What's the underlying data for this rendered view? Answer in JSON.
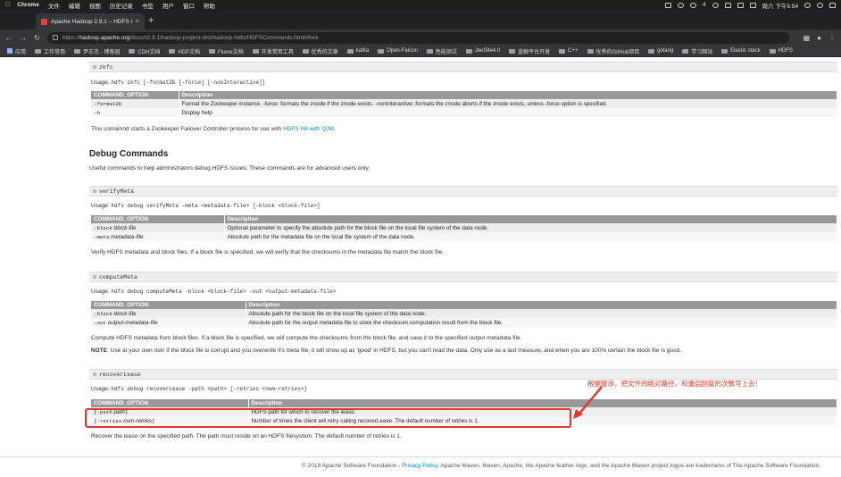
{
  "menubar": {
    "app": "Chrome",
    "items": [
      "文件",
      "编辑",
      "视图",
      "历史记录",
      "书签",
      "用户",
      "窗口",
      "帮助"
    ],
    "badge": "4",
    "clock": "周六 下午5:54"
  },
  "tab": {
    "title": "Apache Hadoop 2.9.1 – HDFS C",
    "close": "×"
  },
  "newtab": "+",
  "address": {
    "scheme": "https://",
    "host": "hadoop.apache.org",
    "path": "/docs/r2.9.1/hadoop-project-dist/hadoop-hdfs/HDFSCommands.html#fsck"
  },
  "bookmarks": [
    "应用",
    "工作常用",
    "尹正杰 - 博客园",
    "CDH文档",
    "HDP文档",
    "Flume文档",
    "开发常用工具",
    "优秀的文章",
    "kafka",
    "Open-Falcon",
    "性能测试",
    "JeeSite4.0",
    "蓝鲸平台开发",
    "C++",
    "优秀的GitHub项目",
    "golang",
    "学习网站",
    "Elastic stack",
    "HDFS"
  ],
  "zkfc": {
    "heading": "zkfc",
    "usage_label": "Usage: ",
    "usage_code": "hdfs zkfc [-formatZK [-force] [-nonInteractive]]",
    "headers": [
      "COMMAND_OPTION",
      "Description"
    ],
    "rows": [
      {
        "opt": "-formatZK",
        "desc": "Format the Zookeeper instance. -force: formats the znode if the znode exists. -nonInteractive: formats the znode aborts if the znode exists, unless -force option is specified."
      },
      {
        "opt": "-h",
        "desc": "Display help"
      }
    ],
    "note_pre": "This comamnd starts a Zookeeper Failover Controller process for use with ",
    "note_link": "HDFS HA with QJM",
    "note_post": "."
  },
  "debug": {
    "heading": "Debug Commands",
    "intro": "Useful commands to help administrators debug HDFS issues. These commands are for advanced users only."
  },
  "verifyMeta": {
    "heading": "verifyMeta",
    "usage_label": "Usage: ",
    "usage_code": "hdfs debug verifyMeta -meta <metadata-file> [-block <block-file>]",
    "headers": [
      "COMMAND_OPTION",
      "Description"
    ],
    "rows": [
      {
        "opt": "-block",
        "arg": "block-file",
        "desc": "Optional parameter to specify the absolute path for the block file on the local file system of the data node."
      },
      {
        "opt": "-meta",
        "arg": "metadata-file",
        "desc": "Absolute path for the metadata file on the local file system of the data node."
      }
    ],
    "note": "Verify HDFS metadata and block files. If a block file is specified, we will verify that the checksums in the metadata file match the block file."
  },
  "computeMeta": {
    "heading": "computeMeta",
    "usage_label": "Usage: ",
    "usage_code": "hdfs debug computeMeta -block <block-file> -out <output-metadata-file>",
    "headers": [
      "COMMAND_OPTION",
      "Description"
    ],
    "rows": [
      {
        "opt": "-block",
        "arg": "block-file",
        "desc": "Absolute path for the block file on the local file system of the data node."
      },
      {
        "opt": "-out",
        "arg": "output-metadata-file",
        "desc": "Absolute path for the output metadata file to store the checksum computation result from the block file."
      }
    ],
    "note": "Compute HDFS metadata from block files. If a block file is specified, we will compute the checksums from the block file, and save it to the specified output metadata file.",
    "warn_label": "NOTE",
    "warn_text": ": Use at your own risk! If the block file is corrupt and you overwrite it's meta file, it will show up as 'good' in HDFS, but you can't read the data. Only use as a last measure, and when you are 100% certain the block file is good."
  },
  "recoverLease": {
    "heading": "recoverLease",
    "usage_label": "Usage: ",
    "usage_code": "hdfs debug recoverLease -path <path> [-retries <num-retries>]",
    "headers": [
      "COMMAND_OPTION",
      "Description"
    ],
    "rows": [
      {
        "opt": "[-path",
        "arg": "path",
        "close": "]",
        "desc": "HDFS path for which to recover the lease."
      },
      {
        "opt": "[-retries",
        "arg": "num-retries",
        "close": "]",
        "desc": "Number of times the client will retry calling recoverLease. The default number of retries is 1."
      }
    ],
    "note": "Recover the lease on the specified path. The path must reside on an HDFS filesystem. The default number of retries is 1."
  },
  "annotation": "根据提示，把文件的绝对路径，和重启回复的次数写上去！",
  "footer": {
    "pre": "© 2018 Apache Software Foundation - ",
    "link": "Privacy Policy",
    "post": ". Apache Maven, Maven, Apache, the Apache feather logo, and the Apache Maven project logos are trademarks of The Apache Software Foundation."
  },
  "colors": {
    "annotation": "#e5362b",
    "link": "#0088cc",
    "table_header": "#999999"
  }
}
